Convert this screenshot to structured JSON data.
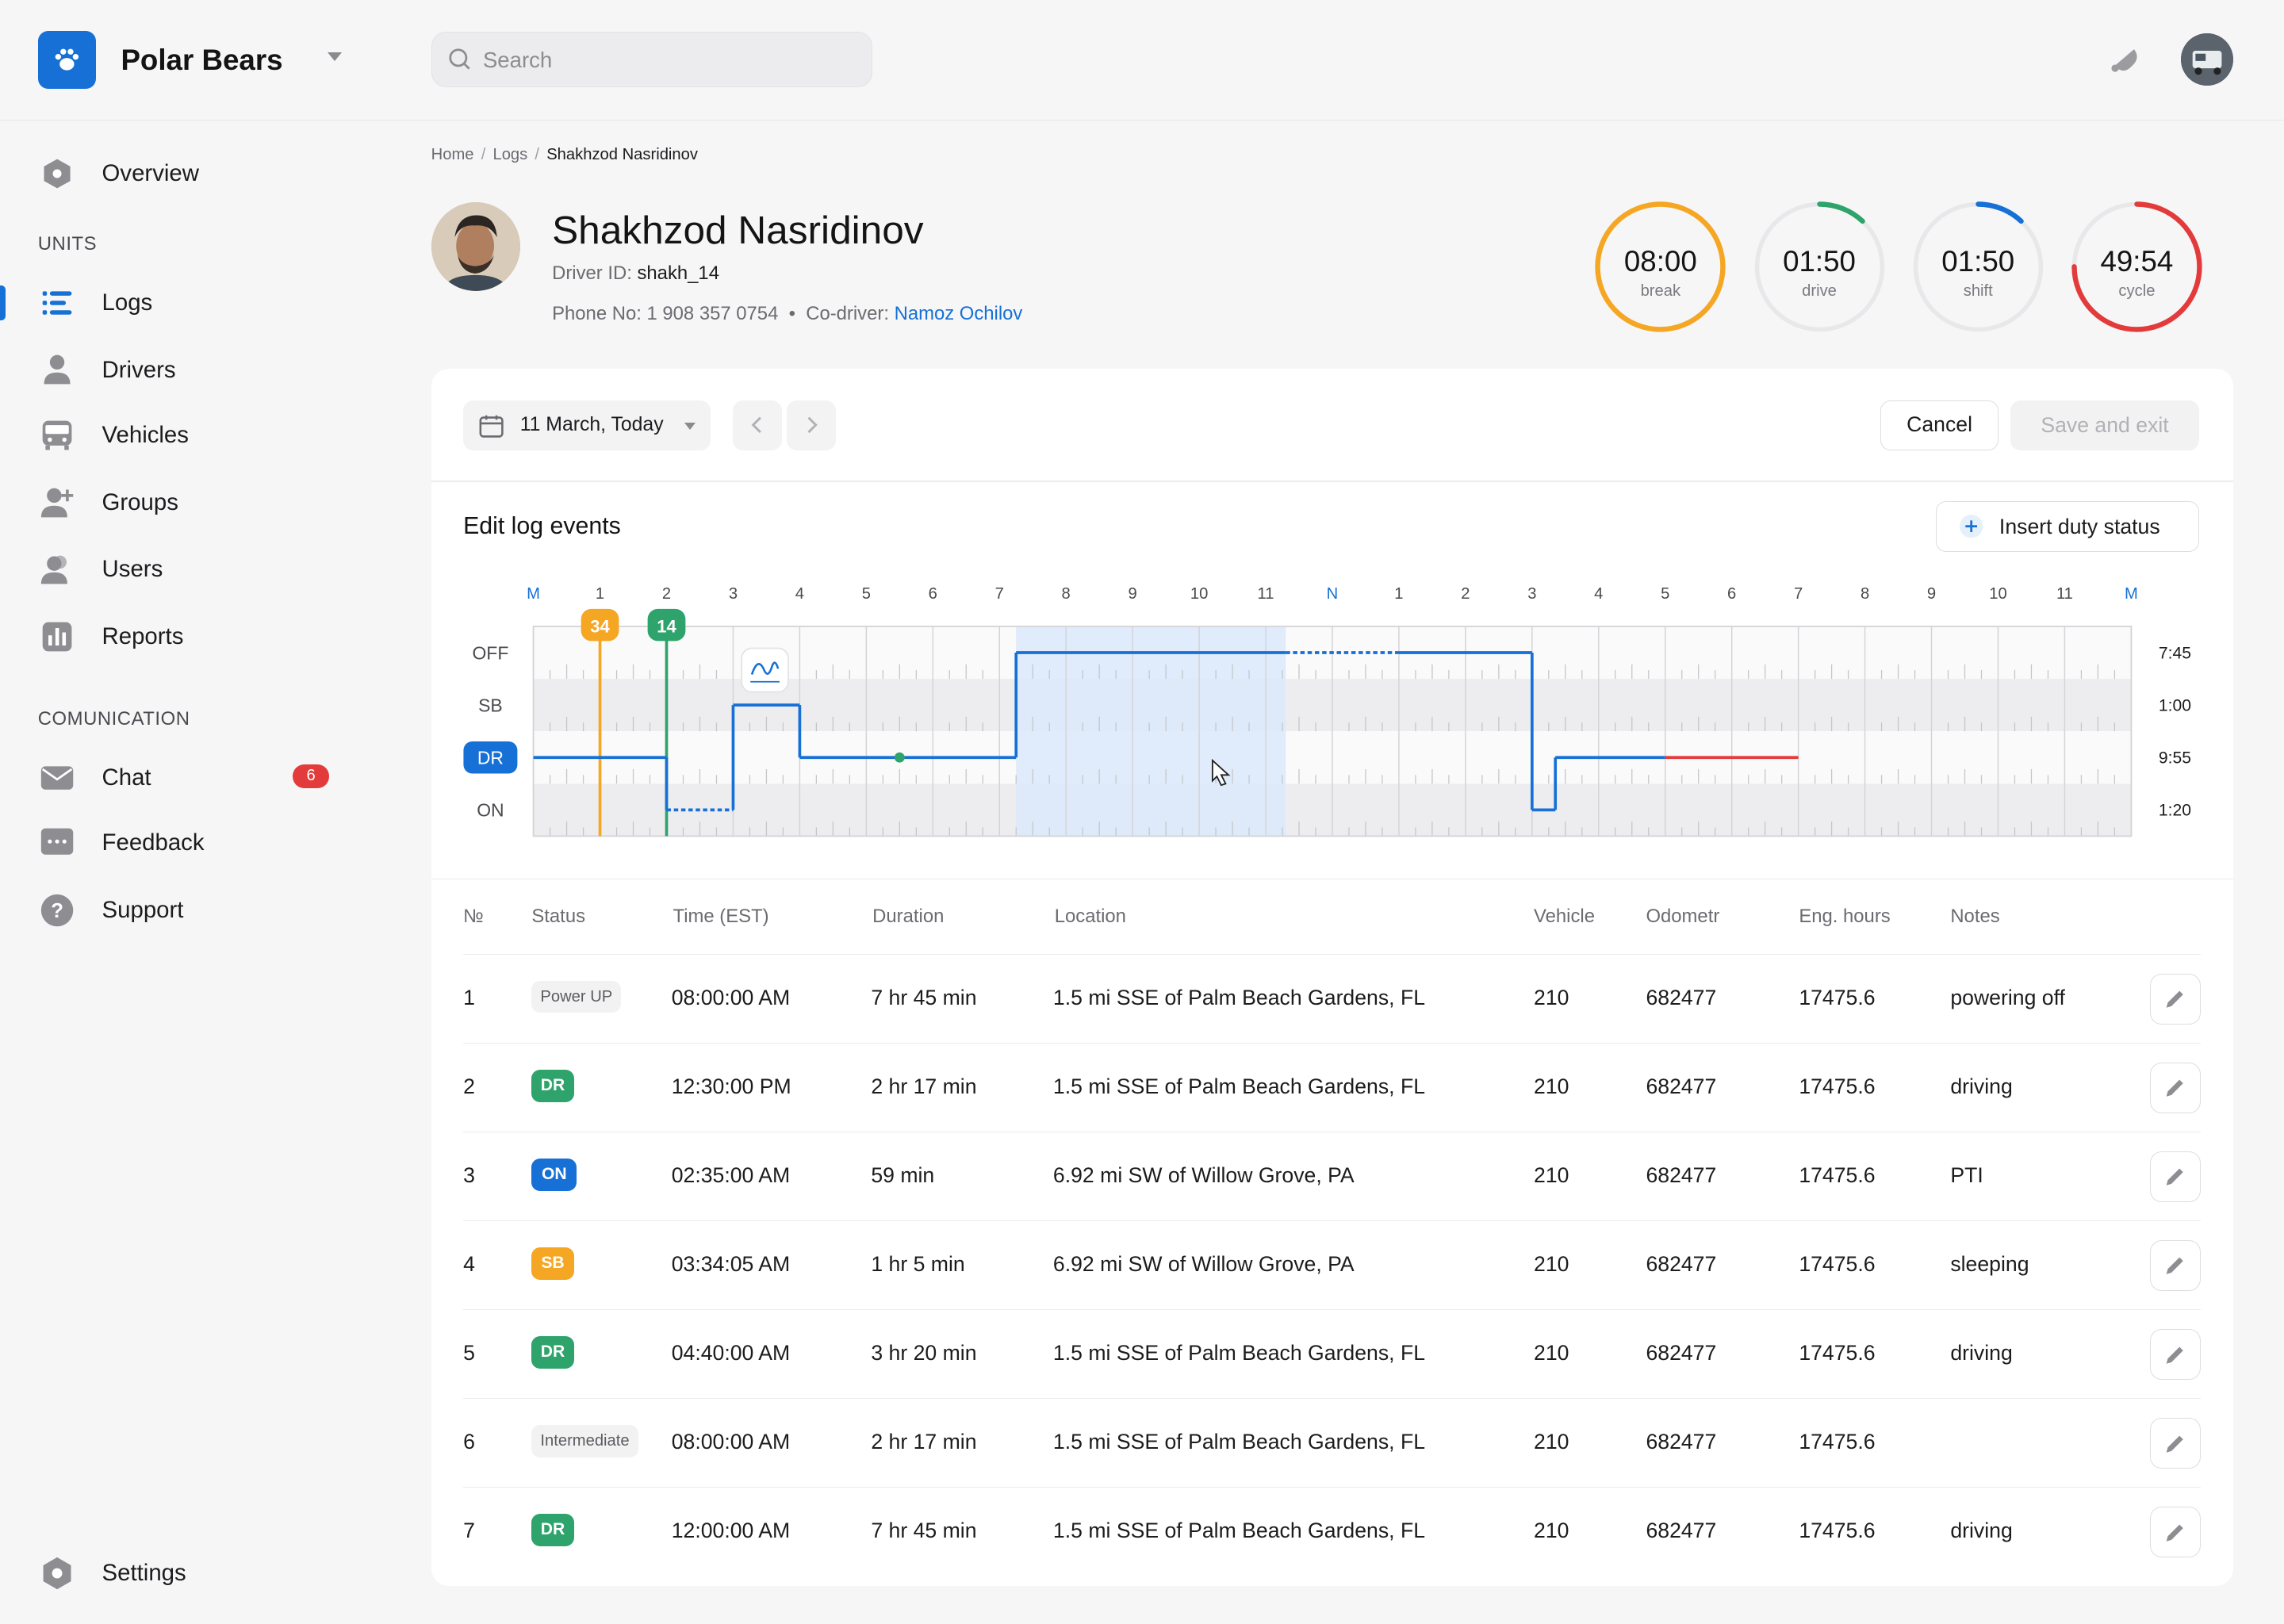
{
  "app": {
    "brand": "Polar Bears",
    "search_placeholder": "Search"
  },
  "sidebar": {
    "items_main": [
      {
        "label": "Overview",
        "icon": "hexagon-icon"
      }
    ],
    "section_units": "UNITS",
    "items_units": [
      {
        "label": "Logs",
        "icon": "list-icon",
        "active": true
      },
      {
        "label": "Drivers",
        "icon": "person-icon"
      },
      {
        "label": "Vehicles",
        "icon": "bus-icon"
      },
      {
        "label": "Groups",
        "icon": "add-user-icon"
      },
      {
        "label": "Users",
        "icon": "users-icon"
      },
      {
        "label": "Reports",
        "icon": "bar-chart-icon"
      }
    ],
    "section_comm": "COMUNICATION",
    "items_comm": [
      {
        "label": "Chat",
        "icon": "mail-icon",
        "badge": "6"
      },
      {
        "label": "Feedback",
        "icon": "message-icon"
      },
      {
        "label": "Support",
        "icon": "help-icon"
      }
    ],
    "settings": "Settings"
  },
  "breadcrumb": [
    "Home",
    "Logs",
    "Shakhzod Nasridinov"
  ],
  "driver": {
    "name": "Shakhzod Nasridinov",
    "id_label": "Driver ID:",
    "id": "shakh_14",
    "phone_label": "Phone No:",
    "phone": "1 908 357 0754",
    "codriver_label": "Co-driver:",
    "codriver": "Namoz Ochilov"
  },
  "timers": [
    {
      "value": "08:00",
      "label": "break",
      "color": "#f5a623",
      "progress": 1.0
    },
    {
      "value": "01:50",
      "label": "drive",
      "color": "#2ea36b",
      "progress": 0.12
    },
    {
      "value": "01:50",
      "label": "shift",
      "color": "#1670d6",
      "progress": 0.12
    },
    {
      "value": "49:54",
      "label": "cycle",
      "color": "#e33b3b",
      "progress": 0.75
    }
  ],
  "toolbar": {
    "date": "11 March, Today",
    "cancel": "Cancel",
    "save": "Save and exit"
  },
  "editor": {
    "title": "Edit log events",
    "insert": "Insert duty status"
  },
  "chart_data": {
    "type": "duty-status-log",
    "hours": [
      "M",
      "1",
      "2",
      "3",
      "4",
      "5",
      "6",
      "7",
      "8",
      "9",
      "10",
      "11",
      "N",
      "1",
      "2",
      "3",
      "4",
      "5",
      "6",
      "7",
      "8",
      "9",
      "10",
      "11",
      "M"
    ],
    "rows": [
      {
        "label": "OFF",
        "total": "7:45"
      },
      {
        "label": "SB",
        "total": "1:00"
      },
      {
        "label": "DR",
        "total": "9:55",
        "active": true
      },
      {
        "label": "ON",
        "total": "1:20"
      }
    ],
    "markers": [
      {
        "label": "34",
        "hour": 1.0,
        "color": "#f5a623"
      },
      {
        "label": "14",
        "hour": 2.0,
        "color": "#2ea36b"
      }
    ],
    "segments": [
      {
        "status": "DR",
        "start": 0,
        "end": 2
      },
      {
        "status": "ON",
        "start": 2,
        "end": 3,
        "style": "dotted"
      },
      {
        "status": "SB",
        "start": 3,
        "end": 4
      },
      {
        "status": "DR",
        "start": 4,
        "end": 7.25
      },
      {
        "status": "OFF",
        "start": 7.25,
        "end": 11.3
      },
      {
        "status": "OFF",
        "start": 11.3,
        "end": 13,
        "style": "dotted"
      },
      {
        "status": "OFF",
        "start": 13,
        "end": 15
      },
      {
        "status": "ON",
        "start": 15,
        "end": 15.35
      },
      {
        "status": "DR",
        "start": 15.35,
        "end": 17
      },
      {
        "status": "DR",
        "start": 17,
        "end": 19,
        "color": "#e33b3b"
      }
    ],
    "selection": {
      "start": 7.25,
      "end": 11.3
    },
    "signature_hour": 3.5,
    "green_dot_hour": 5.5
  },
  "table": {
    "headers": [
      "№",
      "Status",
      "Time (EST)",
      "Duration",
      "Location",
      "Vehicle",
      "Odometr",
      "Eng. hours",
      "Notes"
    ],
    "rows": [
      {
        "n": "1",
        "status": "Power UP",
        "kind": "grey",
        "time": "08:00:00 AM",
        "duration": "7 hr 45 min",
        "location": "1.5 mi SSE of Palm Beach Gardens, FL",
        "vehicle": "210",
        "odo": "682477",
        "eng": "17475.6",
        "notes": "powering off"
      },
      {
        "n": "2",
        "status": "DR",
        "kind": "dr",
        "time": "12:30:00 PM",
        "duration": "2 hr 17 min",
        "location": "1.5 mi SSE of Palm Beach Gardens, FL",
        "vehicle": "210",
        "odo": "682477",
        "eng": "17475.6",
        "notes": "driving"
      },
      {
        "n": "3",
        "status": "ON",
        "kind": "on",
        "time": "02:35:00 AM",
        "duration": "59 min",
        "location": "6.92 mi SW of Willow Grove, PA",
        "vehicle": "210",
        "odo": "682477",
        "eng": "17475.6",
        "notes": "PTI"
      },
      {
        "n": "4",
        "status": "SB",
        "kind": "sb",
        "time": "03:34:05 AM",
        "duration": "1 hr 5 min",
        "location": "6.92 mi SW of Willow Grove, PA",
        "vehicle": "210",
        "odo": "682477",
        "eng": "17475.6",
        "notes": "sleeping"
      },
      {
        "n": "5",
        "status": "DR",
        "kind": "dr",
        "time": "04:40:00 AM",
        "duration": "3 hr 20 min",
        "location": "1.5 mi SSE of Palm Beach Gardens, FL",
        "vehicle": "210",
        "odo": "682477",
        "eng": "17475.6",
        "notes": "driving"
      },
      {
        "n": "6",
        "status": "Intermediate",
        "kind": "grey",
        "time": "08:00:00 AM",
        "duration": "2 hr 17 min",
        "location": "1.5 mi SSE of Palm Beach Gardens, FL",
        "vehicle": "210",
        "odo": "682477",
        "eng": "17475.6",
        "notes": ""
      },
      {
        "n": "7",
        "status": "DR",
        "kind": "dr",
        "time": "12:00:00 AM",
        "duration": "7 hr 45 min",
        "location": "1.5 mi SSE of Palm Beach Gardens, FL",
        "vehicle": "210",
        "odo": "682477",
        "eng": "17475.6",
        "notes": "driving"
      }
    ]
  },
  "colors": {
    "accent": "#1670d6",
    "dr": "#2ea36b",
    "on": "#1670d6",
    "sb": "#f5a623",
    "alert": "#e33b3b"
  }
}
